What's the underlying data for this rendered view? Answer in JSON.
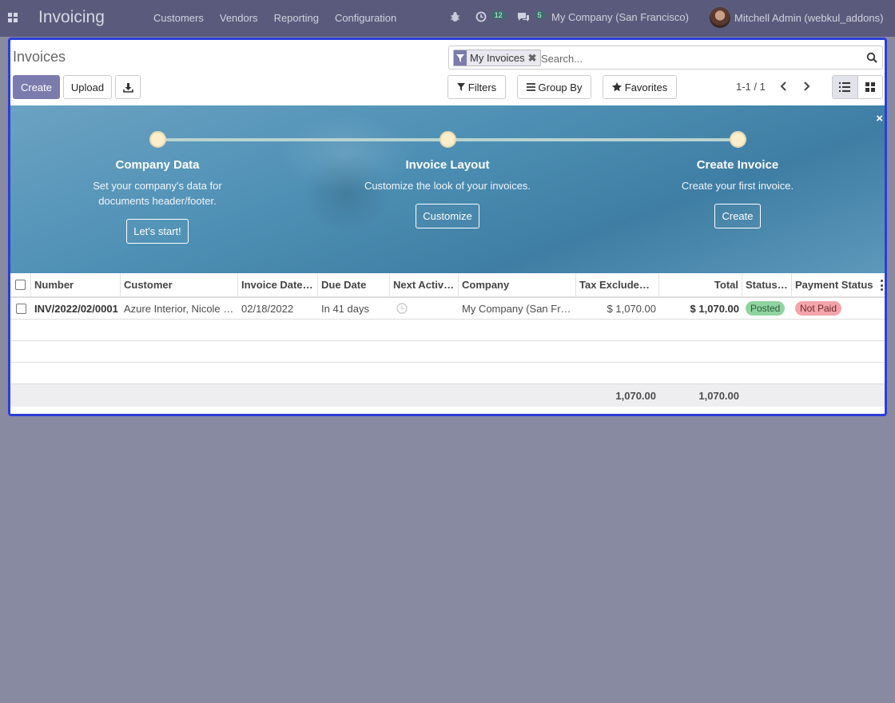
{
  "navbar": {
    "brand": "Invoicing",
    "menu": [
      "Customers",
      "Vendors",
      "Reporting",
      "Configuration"
    ],
    "activity_count": "12",
    "message_count": "5",
    "company": "My Company (San Francisco)",
    "user": "Mitchell Admin (webkul_addons)"
  },
  "control": {
    "title": "Invoices",
    "create_label": "Create",
    "upload_label": "Upload",
    "search": {
      "facet": "My Invoices",
      "placeholder": "Search..."
    },
    "filters_label": "Filters",
    "groupby_label": "Group By",
    "favorites_label": "Favorites",
    "pager": "1-1 / 1"
  },
  "banner": {
    "steps": [
      {
        "title": "Company Data",
        "desc_line1": "Set your company's data for",
        "desc_line2": "documents header/footer.",
        "button": "Let's start!"
      },
      {
        "title": "Invoice Layout",
        "desc_line1": "Customize the look of your invoices.",
        "desc_line2": "",
        "button": "Customize"
      },
      {
        "title": "Create Invoice",
        "desc_line1": "Create your first invoice.",
        "desc_line2": "",
        "button": "Create"
      }
    ],
    "close": "×"
  },
  "table": {
    "columns": [
      "Number",
      "Customer",
      "Invoice Date…",
      "Due Date",
      "Next Activ…",
      "Company",
      "Tax Exclude…",
      "Total",
      "Status…",
      "Payment Status"
    ],
    "rows": [
      {
        "number": "INV/2022/02/0001",
        "customer": "Azure Interior, Nicole …",
        "invoice_date": "02/18/2022",
        "due_date": "In 41 days",
        "company": "My Company (San Fr…",
        "tax_excluded": "$ 1,070.00",
        "total": "$ 1,070.00",
        "status": "Posted",
        "payment_status": "Not Paid"
      }
    ],
    "footer": {
      "tax_excluded": "1,070.00",
      "total": "1,070.00"
    }
  },
  "colors": {
    "navbar": "#5a5b7c",
    "primary": "#7c7bad",
    "posted": "#8fd3a0",
    "not_paid": "#f5a4aa",
    "banner": "#4e90b5"
  }
}
